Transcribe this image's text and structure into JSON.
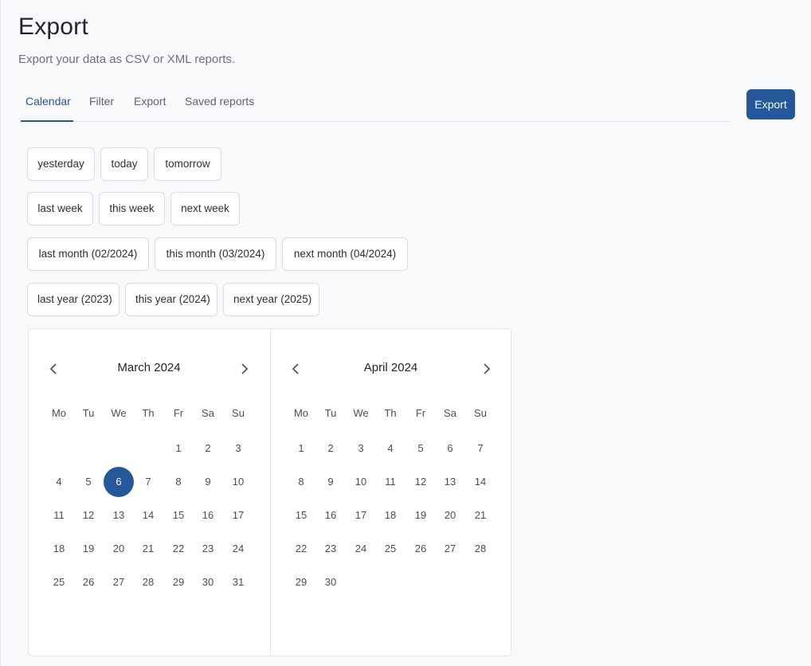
{
  "header": {
    "title": "Export",
    "subtitle": "Export your data as CSV or XML reports."
  },
  "tabs": [
    "Calendar",
    "Filter",
    "Export",
    "Saved reports"
  ],
  "active_tab": "Calendar",
  "export_button": "Export",
  "quick_ranges": [
    [
      "yesterday",
      "today",
      "tomorrow"
    ],
    [
      "last week",
      "this week",
      "next week"
    ],
    [
      "last month (02/2024)",
      "this month (03/2024)",
      "next month (04/2024)"
    ],
    [
      "last year (2023)",
      "this year (2024)",
      "next year (2025)"
    ]
  ],
  "weekdays": [
    "Mo",
    "Tu",
    "We",
    "Th",
    "Fr",
    "Sa",
    "Su"
  ],
  "months": [
    {
      "title": "March 2024",
      "offset": 4,
      "days": 31,
      "selected": 6
    },
    {
      "title": "April 2024",
      "offset": 0,
      "days": 30,
      "selected": null
    }
  ],
  "colors": {
    "accent": "#24589b",
    "background": "#f8f9fb"
  },
  "icons": {
    "prev": "chevron-left-icon",
    "next": "chevron-right-icon"
  }
}
